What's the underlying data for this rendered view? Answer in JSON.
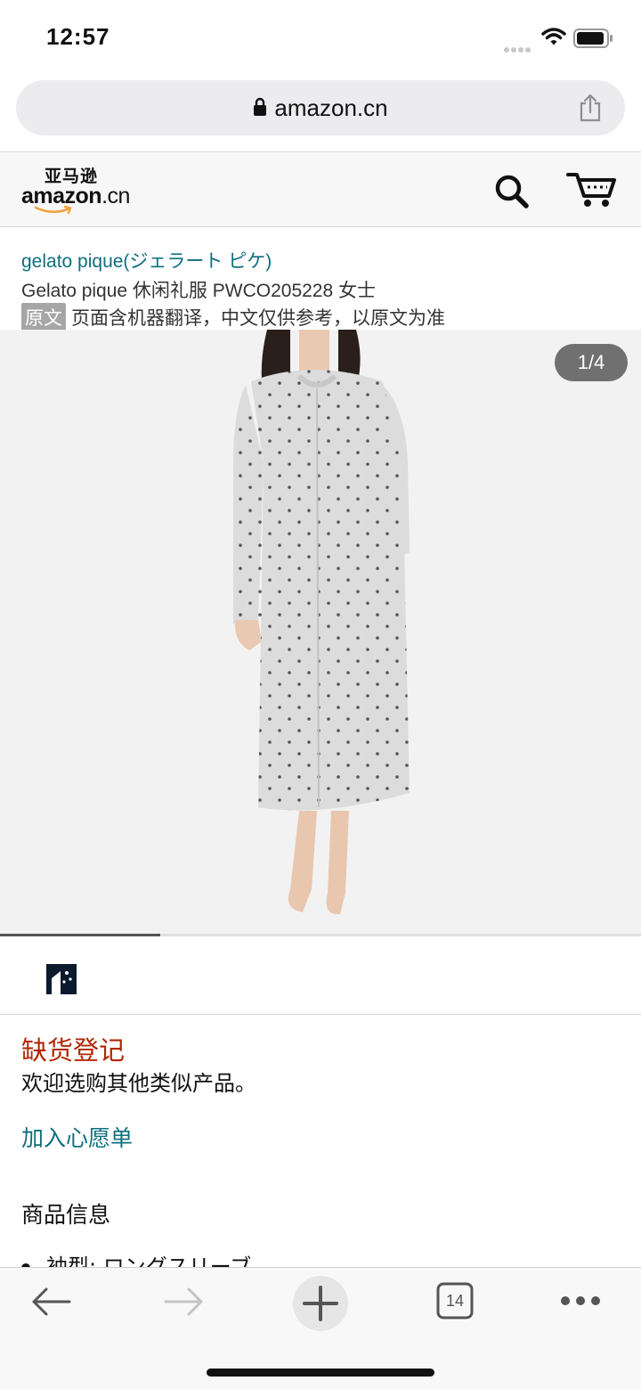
{
  "status_bar": {
    "time": "12:57"
  },
  "browser": {
    "url": "amazon.cn",
    "tab_count": "14"
  },
  "header": {
    "logo_cn": "亚马逊",
    "logo_en": "amazon",
    "logo_tld": ".cn"
  },
  "product": {
    "brand": "gelato pique(ジェラート ピケ)",
    "title": "Gelato pique 休闲礼服 PWCO205228 女士",
    "translate_badge": "原文",
    "translate_note": "页面含机器翻译，中文仅供参考，以原文为准",
    "image_counter": "1/4",
    "image_progress": 0.25
  },
  "availability": {
    "status": "缺货登记",
    "message": "欢迎选购其他类似产品。",
    "wishlist_link": "加入心愿单"
  },
  "info": {
    "heading": "商品信息",
    "bullets": [
      "袖型: ロングスリーブ"
    ]
  },
  "colors": {
    "link": "#0e6f7d",
    "out_of_stock": "#b12704"
  }
}
